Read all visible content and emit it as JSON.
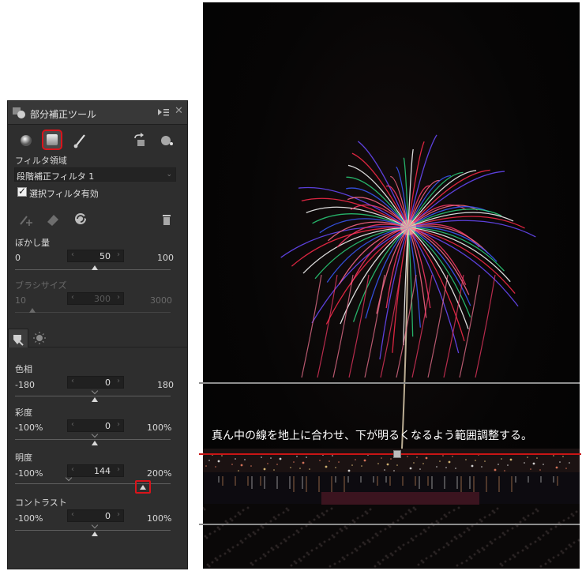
{
  "panel": {
    "title": "部分補正ツール",
    "filter_area_label": "フィルタ領域",
    "filter_selected": "段階補正フィルタ 1",
    "enable_filter_label": "選択フィルタ有効",
    "enable_filter_checked": true,
    "blur": {
      "label": "ぼかし量",
      "min": "0",
      "max": "100",
      "value": "50"
    },
    "brush": {
      "label": "ブラシサイズ",
      "min": "10",
      "max": "3000",
      "value": "300"
    },
    "sliders": [
      {
        "label": "色相",
        "min": "-180",
        "max": "180",
        "value": "0"
      },
      {
        "label": "彩度",
        "min": "-100%",
        "max": "100%",
        "value": "0"
      },
      {
        "label": "明度",
        "min": "-100%",
        "max": "200%",
        "value": "144"
      },
      {
        "label": "コントラスト",
        "min": "-100%",
        "max": "100%",
        "value": "0"
      }
    ],
    "icons": [
      "rounded-circle-filter-icon",
      "gradient-square-filter-icon",
      "brush-filter-icon",
      "paste-settings-icon",
      "mask-display-icon",
      "add-point-icon",
      "eraser-icon",
      "refresh-icon",
      "trash-icon",
      "panel-menu-icon",
      "close-icon"
    ]
  },
  "photo": {
    "caption": "真ん中の線を地上に合わせ、下が明るくなるよう範囲調整する。"
  },
  "colors": {
    "annotation_red": "#d9141b",
    "panel_bg": "#2e2e2e"
  }
}
